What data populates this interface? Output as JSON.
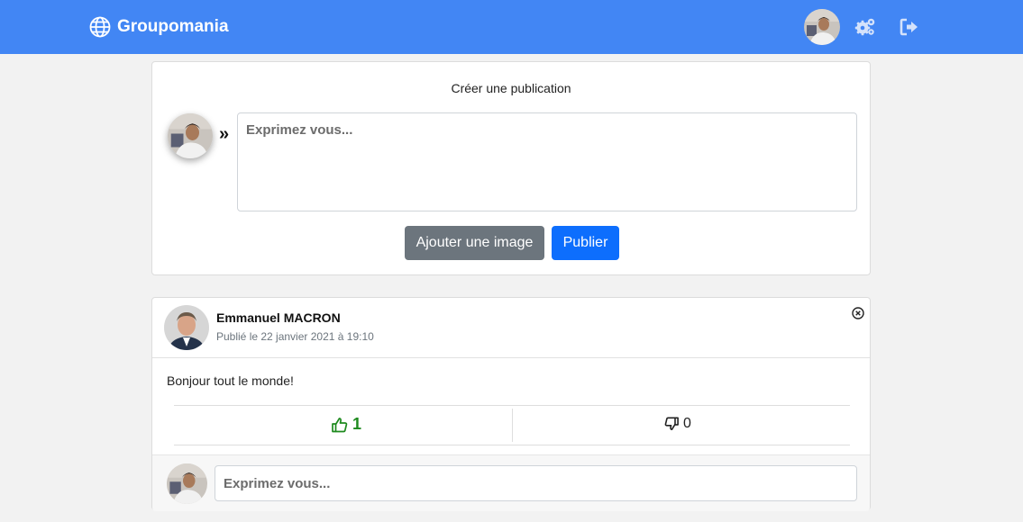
{
  "navbar": {
    "brand": "Groupomania",
    "icons": [
      "globe-icon",
      "user-avatar",
      "gears-icon",
      "sign-out-icon"
    ]
  },
  "composer": {
    "title": "Créer une publication",
    "marker": "»",
    "placeholder": "Exprimez vous...",
    "add_image_label": "Ajouter une image",
    "publish_label": "Publier"
  },
  "post": {
    "author": "Emmanuel MACRON",
    "date": "Publié le 22 janvier 2021 à 19:10",
    "content": "Bonjour tout le monde!",
    "likes": "1",
    "dislikes": "0",
    "comment_placeholder": "Exprimez vous..."
  },
  "colors": {
    "navbar": "#4286f4",
    "primary": "#0d6efd",
    "secondary": "#6c757d",
    "like": "#1e8a1e"
  }
}
